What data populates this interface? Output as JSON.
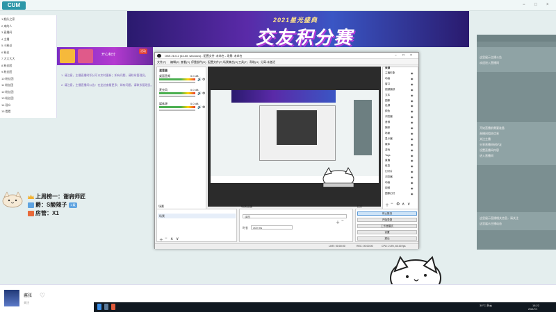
{
  "window": {
    "title": "",
    "controls": [
      "−",
      "□",
      "×"
    ]
  },
  "app": {
    "logo": "CUM"
  },
  "left_panel": {
    "rows": [
      "1 舰队之家",
      "2 来的人",
      "3 直播间",
      "4 主播",
      "5 小粉丝",
      "6 粉丝",
      "7 大大大大",
      "8 粉丝团",
      "9 粉丝团",
      "10 粉丝团",
      "11 粉丝团",
      "12 粉丝团",
      "13 粉丝团",
      "14 观众",
      "15 看看"
    ]
  },
  "banner": {
    "subtitle": "2021星光盛典",
    "title": "交友积分赛"
  },
  "ribbon": {
    "text": "开心积分",
    "badge": "活动"
  },
  "notices": [
    "1. 请注意，主播直播时积分可以实时更新；如有问题，请联系管理员。",
    "2. 请注意，主播直播间公告：在此处查看更多；如有问题，请联系管理员。"
  ],
  "leaderboard": [
    {
      "rank": "1",
      "label": "上周榜一：",
      "name": "谢肩师匠"
    },
    {
      "rank": "2",
      "label": "爵：",
      "name": "S酸辣子",
      "tag": "1 级"
    },
    {
      "rank": "3",
      "label": "房管：",
      "name": "X1"
    }
  ],
  "streamer": {
    "name": "酱张",
    "follow": "关注"
  },
  "right_panel": {
    "heading": "",
    "lines_top": [
      "这里展示主播公告",
      "欢迎进入直播间"
    ],
    "lines_mid": [
      "开始直播前需要准备",
      "直播间相关信息",
      "关注主播",
      "分享直播间给好友",
      "设置直播间内容",
      "进入直播间"
    ],
    "lines_bottom": [
      "这里展示直播相关信息，请关注",
      "这里展示主播动态"
    ]
  },
  "obs": {
    "title": "OBS 26.0.2 (64-bit, windows) - 配置文件: 未命名 - 场景: 未命名",
    "menu": [
      "文件(F)",
      "编辑(E)",
      "查看(V)",
      "停靠部件(D)",
      "配置文件(P)",
      "场景集合(S)",
      "工具(T)",
      "帮助(H)",
      "分离:未激活"
    ],
    "mixer_title": "混音器",
    "mixer": [
      {
        "label": "桌面音频",
        "db": "0.0 dB"
      },
      {
        "label": "麦克风",
        "db": "0.0 dB"
      },
      {
        "label": "媒体源",
        "db": "0.0 dB"
      }
    ],
    "sources_title": "来源",
    "sources": [
      "主播形象",
      "动画",
      "窗口",
      "视频捕获",
      "文本",
      "图像",
      "色源",
      "颜色",
      "浏览器",
      "音频",
      "捕获",
      "场景",
      "显示器",
      "媒体",
      "游戏",
      "Tags",
      "直播",
      "信息",
      "幻灯片",
      "浏览器",
      "动画",
      "视频",
      "图像幻灯"
    ],
    "scenes_title": "场景",
    "scene_item": "场景",
    "transitions_title": "场景过渡",
    "transition": "淡出",
    "duration_label": "时长",
    "duration": "300 ms",
    "controls_title": "控件",
    "controls": [
      "停止推流",
      "开始录制",
      "工作室模式",
      "设置",
      "退出"
    ],
    "status": {
      "live": "LIVE: 00:00:00",
      "rec": "REC: 00:00:00",
      "cpu": "CPU: 2.8%, 60.00 fps"
    }
  },
  "taskbar": {
    "weather": "30°C 多云",
    "time": "18:22",
    "date": "2021/7/1"
  },
  "colors": {
    "accent": "#2d97a8",
    "banner_purple": "#5a2aa8",
    "right_panel": "#7b8f91"
  }
}
